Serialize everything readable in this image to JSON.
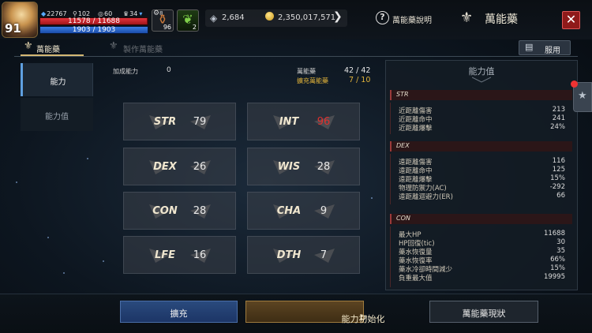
{
  "player": {
    "level": "91",
    "gem_count": "22767",
    "key_count": "102",
    "coin_count": "60",
    "trophy_count": "34",
    "hp_text": "11578 / 11688",
    "mp_text": "1903 / 1903",
    "hp_fraction": 0.99,
    "mp_fraction": 1.0
  },
  "slots": [
    {
      "icon": "potion-icon",
      "glyph": "⚱",
      "gear": "8",
      "count": "96"
    },
    {
      "icon": "leaf-icon",
      "glyph": "❦",
      "count": "2"
    }
  ],
  "currency": {
    "crystal": "2,684",
    "gold": "2,350,017,571"
  },
  "header": {
    "help_label": "萬能藥說明",
    "title": "萬能藥",
    "close_glyph": "✕"
  },
  "tabs": {
    "tab1": "萬能藥",
    "tab2": "製作萬能藥",
    "use_label": "服用"
  },
  "nav": {
    "ability": "能力",
    "stat": "能力值"
  },
  "info": {
    "add_label": "加成能力",
    "add_value": "0",
    "elixir_label": "萬能藥",
    "elixir_value": "42 / 42",
    "expand_label": "擴充萬能藥",
    "expand_value": "7 / 10"
  },
  "stats": [
    {
      "key": "str",
      "name": "STR",
      "value": "79",
      "highlight": false
    },
    {
      "key": "int",
      "name": "INT",
      "value": "96",
      "highlight": true
    },
    {
      "key": "dex",
      "name": "DEX",
      "value": "26",
      "highlight": false
    },
    {
      "key": "wis",
      "name": "WIS",
      "value": "28",
      "highlight": false
    },
    {
      "key": "con",
      "name": "CON",
      "value": "28",
      "highlight": false
    },
    {
      "key": "cha",
      "name": "CHA",
      "value": "9",
      "highlight": false
    },
    {
      "key": "lfe",
      "name": "LFE",
      "value": "16",
      "highlight": false
    },
    {
      "key": "dth",
      "name": "DTH",
      "value": "7",
      "highlight": false
    }
  ],
  "panel": {
    "title": "能力值",
    "groups": [
      {
        "name": "STR",
        "rows": [
          {
            "k": "近距離傷害",
            "v": "213"
          },
          {
            "k": "近距離命中",
            "v": "241"
          },
          {
            "k": "近距離爆擊",
            "v": "24%"
          }
        ]
      },
      {
        "name": "DEX",
        "rows": [
          {
            "k": "遠距離傷害",
            "v": "116"
          },
          {
            "k": "遠距離命中",
            "v": "125"
          },
          {
            "k": "遠距離爆擊",
            "v": "15%"
          },
          {
            "k": "物理防禦力(AC)",
            "v": "-292"
          },
          {
            "k": "遠距離迴避力(ER)",
            "v": "66"
          }
        ]
      },
      {
        "name": "CON",
        "rows": [
          {
            "k": "最大HP",
            "v": "11688"
          },
          {
            "k": "HP回復(tic)",
            "v": "30"
          },
          {
            "k": "藥水恢復量",
            "v": "35"
          },
          {
            "k": "藥水恢復率",
            "v": "66%"
          },
          {
            "k": "藥水冷卻時間減少",
            "v": "15%"
          },
          {
            "k": "負重最大值",
            "v": "19995"
          }
        ]
      }
    ]
  },
  "buttons": {
    "expand": "擴充",
    "reset": "能力初始化",
    "status": "萬能藥現狀"
  },
  "colors": {
    "highlight_red": "#e0302e",
    "accent_gold": "#e0b23a",
    "nav_active": "#5fa0e0"
  }
}
